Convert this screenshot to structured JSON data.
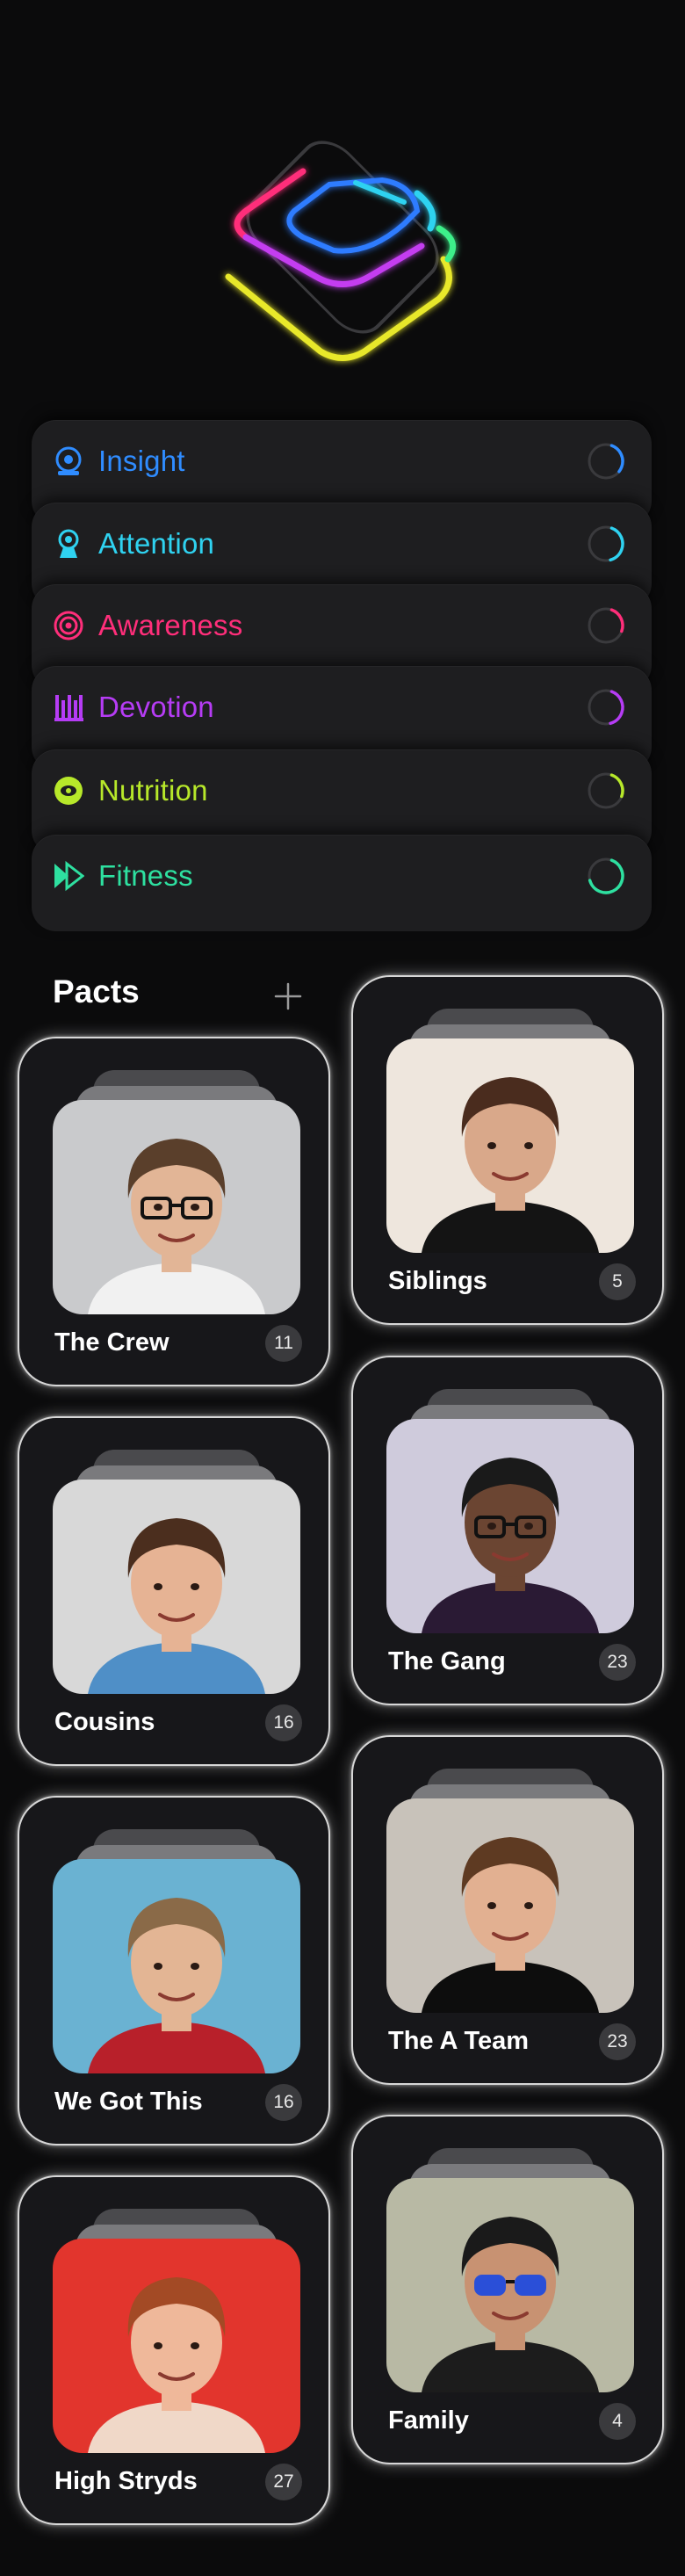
{
  "pillars": [
    {
      "label": "Insight",
      "color": "#2f8cff",
      "icon": "insight-icon",
      "progress": 0.3
    },
    {
      "label": "Attention",
      "color": "#2fd2f0",
      "icon": "attention-icon",
      "progress": 0.4
    },
    {
      "label": "Awareness",
      "color": "#ff2e7a",
      "icon": "awareness-icon",
      "progress": 0.25
    },
    {
      "label": "Devotion",
      "color": "#b63cf5",
      "icon": "devotion-icon",
      "progress": 0.4
    },
    {
      "label": "Nutrition",
      "color": "#b7e82a",
      "icon": "nutrition-icon",
      "progress": 0.25
    },
    {
      "label": "Fitness",
      "color": "#2ee0a0",
      "icon": "fitness-icon",
      "progress": 0.65
    }
  ],
  "pacts": {
    "title": "Pacts",
    "add_icon": "plus-icon",
    "cards": [
      {
        "name": "The Crew",
        "count": "11",
        "bg": "#c9cacc",
        "hair": "#5a3f2b",
        "skin": "#e2b596",
        "shirt": "#f1f1f1",
        "icon": "glasses"
      },
      {
        "name": "Siblings",
        "count": "5",
        "bg": "#eee6dd",
        "hair": "#4a2c1e",
        "skin": "#d9a88a",
        "shirt": "#141414",
        "icon": "none"
      },
      {
        "name": "Cousins",
        "count": "16",
        "bg": "#d8d8d8",
        "hair": "#4b2e1e",
        "skin": "#e6b394",
        "shirt": "#4f8fc7",
        "icon": "none"
      },
      {
        "name": "The Gang",
        "count": "23",
        "bg": "#cfcbdc",
        "hair": "#1a1a1a",
        "skin": "#6b4532",
        "shirt": "#2a1a34",
        "icon": "glasses"
      },
      {
        "name": "We Got This",
        "count": "16",
        "bg": "#6ab2d2",
        "hair": "#8a6a48",
        "skin": "#e3b594",
        "shirt": "#b8202a",
        "icon": "none"
      },
      {
        "name": "The A Team",
        "count": "23",
        "bg": "#c8c2ba",
        "hair": "#5e3a22",
        "skin": "#e2b091",
        "shirt": "#0d0d0d",
        "icon": "none"
      },
      {
        "name": "High Stryds",
        "count": "27",
        "bg": "#e2352d",
        "hair": "#a34a25",
        "skin": "#efb89a",
        "shirt": "#f0d8c8",
        "icon": "none"
      },
      {
        "name": "Family",
        "count": "4",
        "bg": "#b8b9a4",
        "hair": "#1a1a1a",
        "skin": "#c89272",
        "shirt": "#1c1c1c",
        "icon": "sunglasses"
      }
    ]
  }
}
